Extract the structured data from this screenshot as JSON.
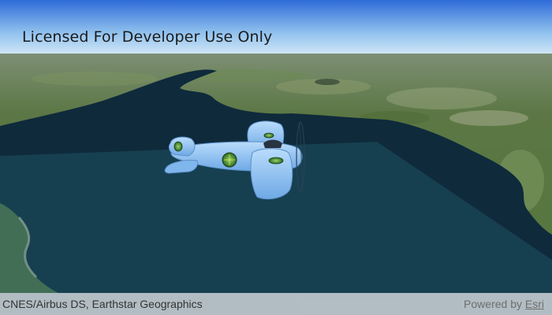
{
  "watermark": {
    "text": "Licensed For Developer Use Only"
  },
  "attribution": {
    "text": "CNES/Airbus DS, Earthstar Geographics",
    "powered_by_label": "Powered by",
    "esri_link": "Esri"
  },
  "colors": {
    "sky_top": "#2f6fdb",
    "sky_horizon": "#d9ecf7",
    "water": "#0f2d3e",
    "airplane": "#8ec3f2",
    "land": "#5f7d45"
  },
  "icons": {
    "airplane": "airplane-3d-model",
    "airplane_emblem": "globe-emblem"
  }
}
